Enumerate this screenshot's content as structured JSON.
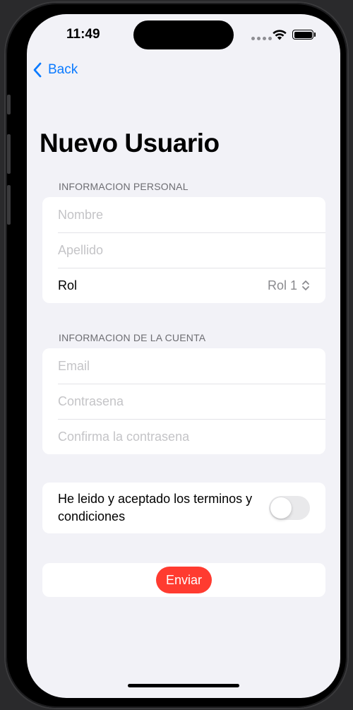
{
  "status_bar": {
    "time": "11:49",
    "signal_icon": "cellular-signal-icon",
    "wifi_icon": "wifi-icon",
    "battery_icon": "battery-icon"
  },
  "nav": {
    "back_label": "Back",
    "back_icon": "chevron-left-icon",
    "title": "Nuevo Usuario"
  },
  "personal_section": {
    "header": "INFORMACION PERSONAL",
    "first_name_placeholder": "Nombre",
    "first_name_value": "",
    "last_name_placeholder": "Apellido",
    "last_name_value": "",
    "role_label": "Rol",
    "role_value": "Rol 1",
    "role_icon": "chevron-up-down-icon"
  },
  "account_section": {
    "header": "INFORMACION DE LA CUENTA",
    "email_placeholder": "Email",
    "email_value": "",
    "password_placeholder": "Contrasena",
    "password_value": "",
    "confirm_placeholder": "Confirma la contrasena",
    "confirm_value": ""
  },
  "terms": {
    "label": "He leido y aceptado los terminos y condiciones",
    "enabled": false
  },
  "submit": {
    "label": "Enviar"
  },
  "colors": {
    "accent": "#0a7aff",
    "submit": "#ff3b30",
    "background": "#f2f2f7",
    "placeholder": "#c4c4c7"
  }
}
